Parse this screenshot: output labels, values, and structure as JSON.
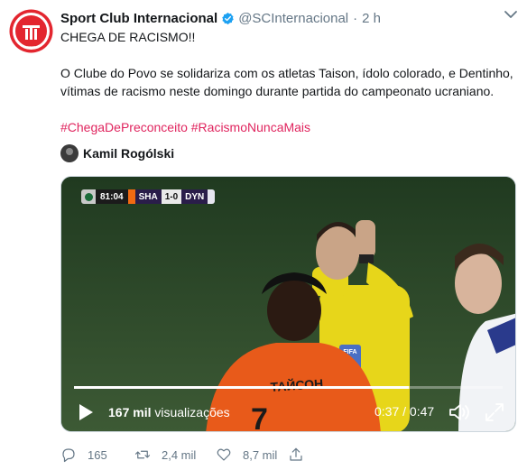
{
  "tweet": {
    "author_name": "Sport Club Internacional",
    "handle": "@SCInternacional",
    "separator": "·",
    "time": "2 h",
    "paragraph1": "CHEGA DE RACISMO!!",
    "paragraph2": "O Clube do Povo se solidariza com os atletas Taison, ídolo colorado, e Dentinho, vítimas de racismo neste domingo durante partida do campeonato ucraniano.",
    "hashtags": [
      "#ChegaDePreconceito",
      "#RacismoNuncaMais"
    ],
    "avatar_logo_text": "S C I",
    "avatar_year": "1909"
  },
  "attribution": {
    "name": "Kamil Rogólski"
  },
  "video": {
    "scorebug": {
      "clock": "81:04",
      "home_team": "SHA",
      "score": "1-0",
      "away_team": "DYN"
    },
    "shirt_text": "ТАЙСОН",
    "badge_text": "FIFA",
    "progress": 0.78,
    "views_count": "167 mil",
    "views_label": "visualizações",
    "current_time": "0:37",
    "time_separator": "/",
    "duration": "0:47"
  },
  "actions": {
    "replies": "165",
    "retweets": "2,4 mil",
    "likes": "8,7 mil"
  },
  "colors": {
    "hashtag": "#e0245e",
    "verified": "#1da1f2",
    "club_red": "#e3262f",
    "muted": "#657786"
  }
}
